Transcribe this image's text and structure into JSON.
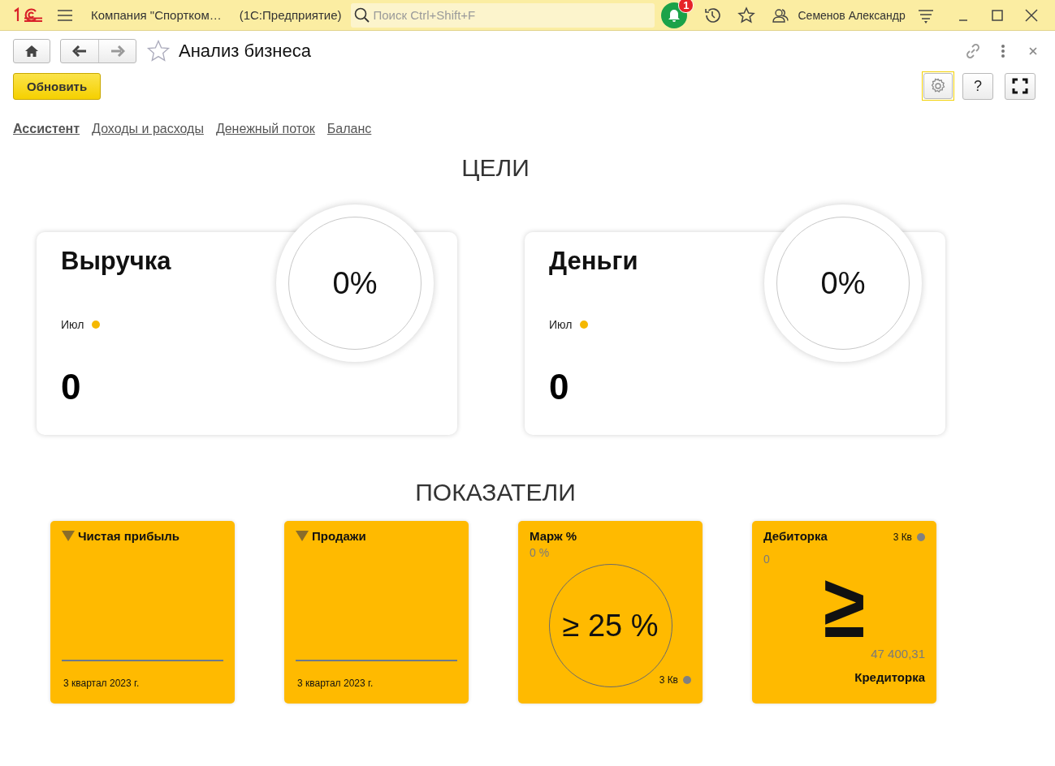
{
  "app_bar": {
    "company": "Компания \"Спортком…",
    "app": "(1С:Предприятие)",
    "search": {
      "placeholder": "Поиск Ctrl+Shift+F"
    },
    "notifications": {
      "count": "1"
    },
    "user": "Семенов Александр"
  },
  "form": {
    "title": "Анализ бизнеса",
    "favorite": false,
    "refresh_button": "Обновить",
    "help_button": "?"
  },
  "tabs": [
    {
      "label": "Ассистент",
      "selected": true
    },
    {
      "label": "Доходы и расходы",
      "selected": false
    },
    {
      "label": "Денежный поток",
      "selected": false
    },
    {
      "label": "Баланс",
      "selected": false
    }
  ],
  "goals": {
    "title": "ЦЕЛИ",
    "cards": [
      {
        "name": "Выручка",
        "period": "Июл",
        "value": "0",
        "percent": "0%"
      },
      {
        "name": "Деньги",
        "period": "Июл",
        "value": "0",
        "percent": "0%"
      }
    ]
  },
  "indicators": {
    "title": "ПОКАЗАТЕЛИ",
    "tiles": [
      {
        "kind": "trend",
        "title": "Чистая прибыль",
        "period": "3 квартал 2023 г."
      },
      {
        "kind": "trend",
        "title": "Продажи",
        "period": "3 квартал 2023 г."
      },
      {
        "kind": "ratio",
        "title": "Марж %",
        "value": "0 %",
        "target": "≥ 25 %",
        "period": "3 Кв"
      },
      {
        "kind": "compare",
        "title": "Дебиторка",
        "period": "3 Кв",
        "value": "0",
        "sign": "≥",
        "other_value": "47 400,31",
        "other_title": "Кредиторка"
      }
    ]
  }
}
